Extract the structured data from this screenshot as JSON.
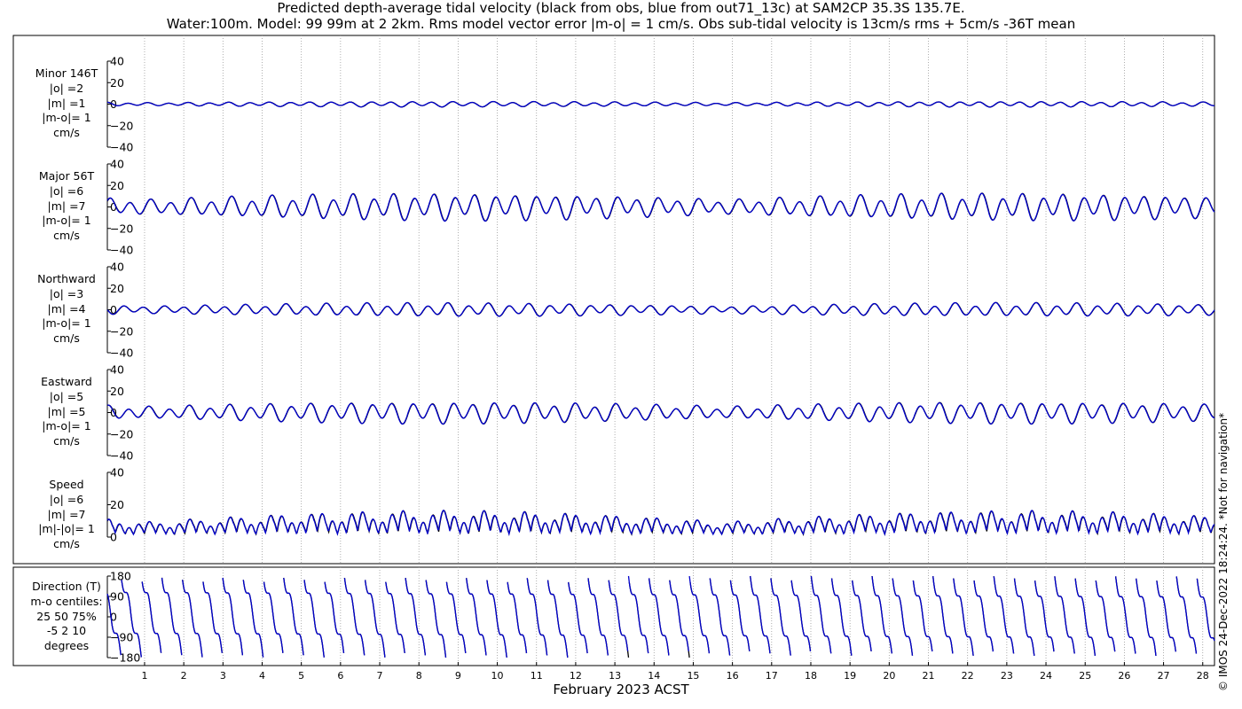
{
  "title": {
    "line1": "Predicted depth-average tidal velocity (black from obs, blue from out71_13c) at SAM2CP 35.3S 135.7E.",
    "line2": "Water:100m. Model: 99 99m at 2 2km. Rms model vector error |m-o| = 1 cm/s. Obs sub-tidal velocity is 13cm/s rms + 5cm/s -36T mean"
  },
  "credit": "© IMOS 24-Dec-2022 18:24:24.  *Not for navigation*",
  "colors": {
    "obs": "#000000",
    "model": "#0000cc",
    "grid": "#9a9a9a"
  },
  "chart_data": {
    "type": "line",
    "xlabel": "February 2023 ACST",
    "x_ticks": [
      "1",
      "2",
      "3",
      "4",
      "5",
      "6",
      "7",
      "8",
      "9",
      "10",
      "11",
      "12",
      "13",
      "14",
      "15",
      "16",
      "17",
      "18",
      "19",
      "20",
      "21",
      "22",
      "23",
      "24",
      "25",
      "26",
      "27",
      "28"
    ],
    "xlim": [
      0.05,
      28.3
    ],
    "grid": true,
    "series_names": [
      "obs",
      "out71_13c"
    ],
    "panels": [
      {
        "id": "minor",
        "label_lines": [
          "Minor 146T",
          "|o| =2",
          "|m| =1",
          "|m-o|= 1",
          "cm/s"
        ],
        "yticks": [
          "40",
          "20",
          "0",
          "−20",
          "−40"
        ],
        "ylim": [
          -40,
          40
        ],
        "amplitude": 2
      },
      {
        "id": "major",
        "label_lines": [
          "Major 56T",
          "|o| =6",
          "|m| =7",
          "|m-o|= 1",
          "cm/s"
        ],
        "yticks": [
          "40",
          "20",
          "0",
          "−20",
          "−40"
        ],
        "ylim": [
          -40,
          40
        ],
        "amplitude": 10
      },
      {
        "id": "north",
        "label_lines": [
          "Northward",
          "|o| =3",
          "|m| =4",
          "|m-o|= 1",
          "cm/s"
        ],
        "yticks": [
          "40",
          "20",
          "0",
          "−20",
          "−40"
        ],
        "ylim": [
          -40,
          40
        ],
        "amplitude": 5
      },
      {
        "id": "east",
        "label_lines": [
          "Eastward",
          "|o| =5",
          "|m| =5",
          "|m-o|= 1",
          "cm/s"
        ],
        "yticks": [
          "40",
          "20",
          "0",
          "−20",
          "−40"
        ],
        "ylim": [
          -40,
          40
        ],
        "amplitude": 8
      },
      {
        "id": "speed",
        "label_lines": [
          "Speed",
          "|o| =6",
          "|m| =7",
          "|m|-|o|= 1",
          "cm/s"
        ],
        "yticks": [
          "40",
          "20",
          "0"
        ],
        "ylim": [
          0,
          40
        ],
        "amplitude": 10
      },
      {
        "id": "direction",
        "label_lines": [
          "Direction (T)",
          "m-o centiles:",
          "25  50  75%",
          "-5   2  10",
          "degrees"
        ],
        "yticks": [
          "180",
          "90",
          "0",
          "−90",
          "−180"
        ],
        "ylim": [
          -180,
          180
        ]
      }
    ]
  }
}
